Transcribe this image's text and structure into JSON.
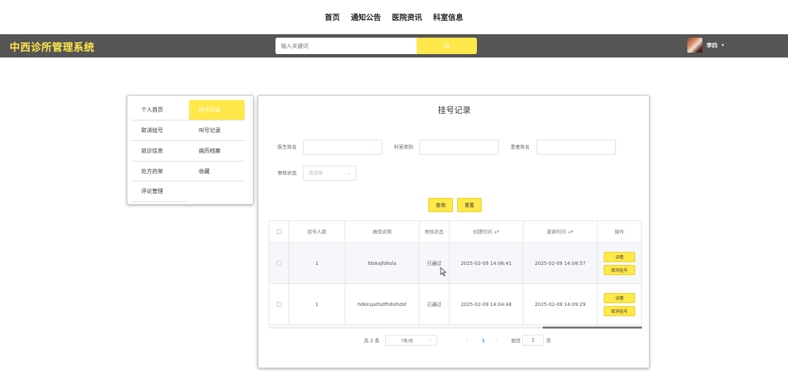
{
  "topnav": {
    "items": [
      "首页",
      "通知公告",
      "医院资讯",
      "科室信息"
    ]
  },
  "header": {
    "brand": "中西诊所管理系统",
    "search_placeholder": "输入关键词",
    "username": "李四",
    "accent": "#ffe84a",
    "bar_color": "#555555"
  },
  "sidebar": {
    "items": [
      "个人首页",
      "挂号记录",
      "取消挂号",
      "叫号记录",
      "就诊信息",
      "病历档案",
      "处方药单",
      "收藏",
      "评论管理"
    ],
    "active": "挂号记录"
  },
  "panel": {
    "title": "挂号记录",
    "filters": {
      "doctor_label": "医生姓名",
      "dept_label": "科室类别",
      "patient_label": "患者姓名",
      "status_label": "审核状态",
      "status_placeholder": "请选择"
    },
    "query_btn": "查询",
    "reset_btn": "重置",
    "table": {
      "headers": [
        "挂号人数",
        "病情说明",
        "审核状态",
        "创建时间",
        "更新时间",
        "操作"
      ],
      "rows": [
        {
          "count": "1",
          "desc": "fdskajfdksla",
          "status": "已通过",
          "created": "2025-02-09 14:06:41",
          "updated": "2025-02-09 14:08:57",
          "detail": "详情",
          "cancel": "取消挂号"
        },
        {
          "count": "1",
          "desc": "hdkksjalfsdfhdslhdsf",
          "status": "已通过",
          "created": "2025-02-09 14:04:48",
          "updated": "2025-02-09 14:09:29",
          "detail": "详情",
          "cancel": "取消挂号"
        }
      ]
    },
    "pagination": {
      "total": "共 2 条",
      "page_size": "7条/页",
      "current_page": "1",
      "goto_prefix": "前往",
      "goto_value": "1",
      "goto_suffix": "页"
    }
  }
}
